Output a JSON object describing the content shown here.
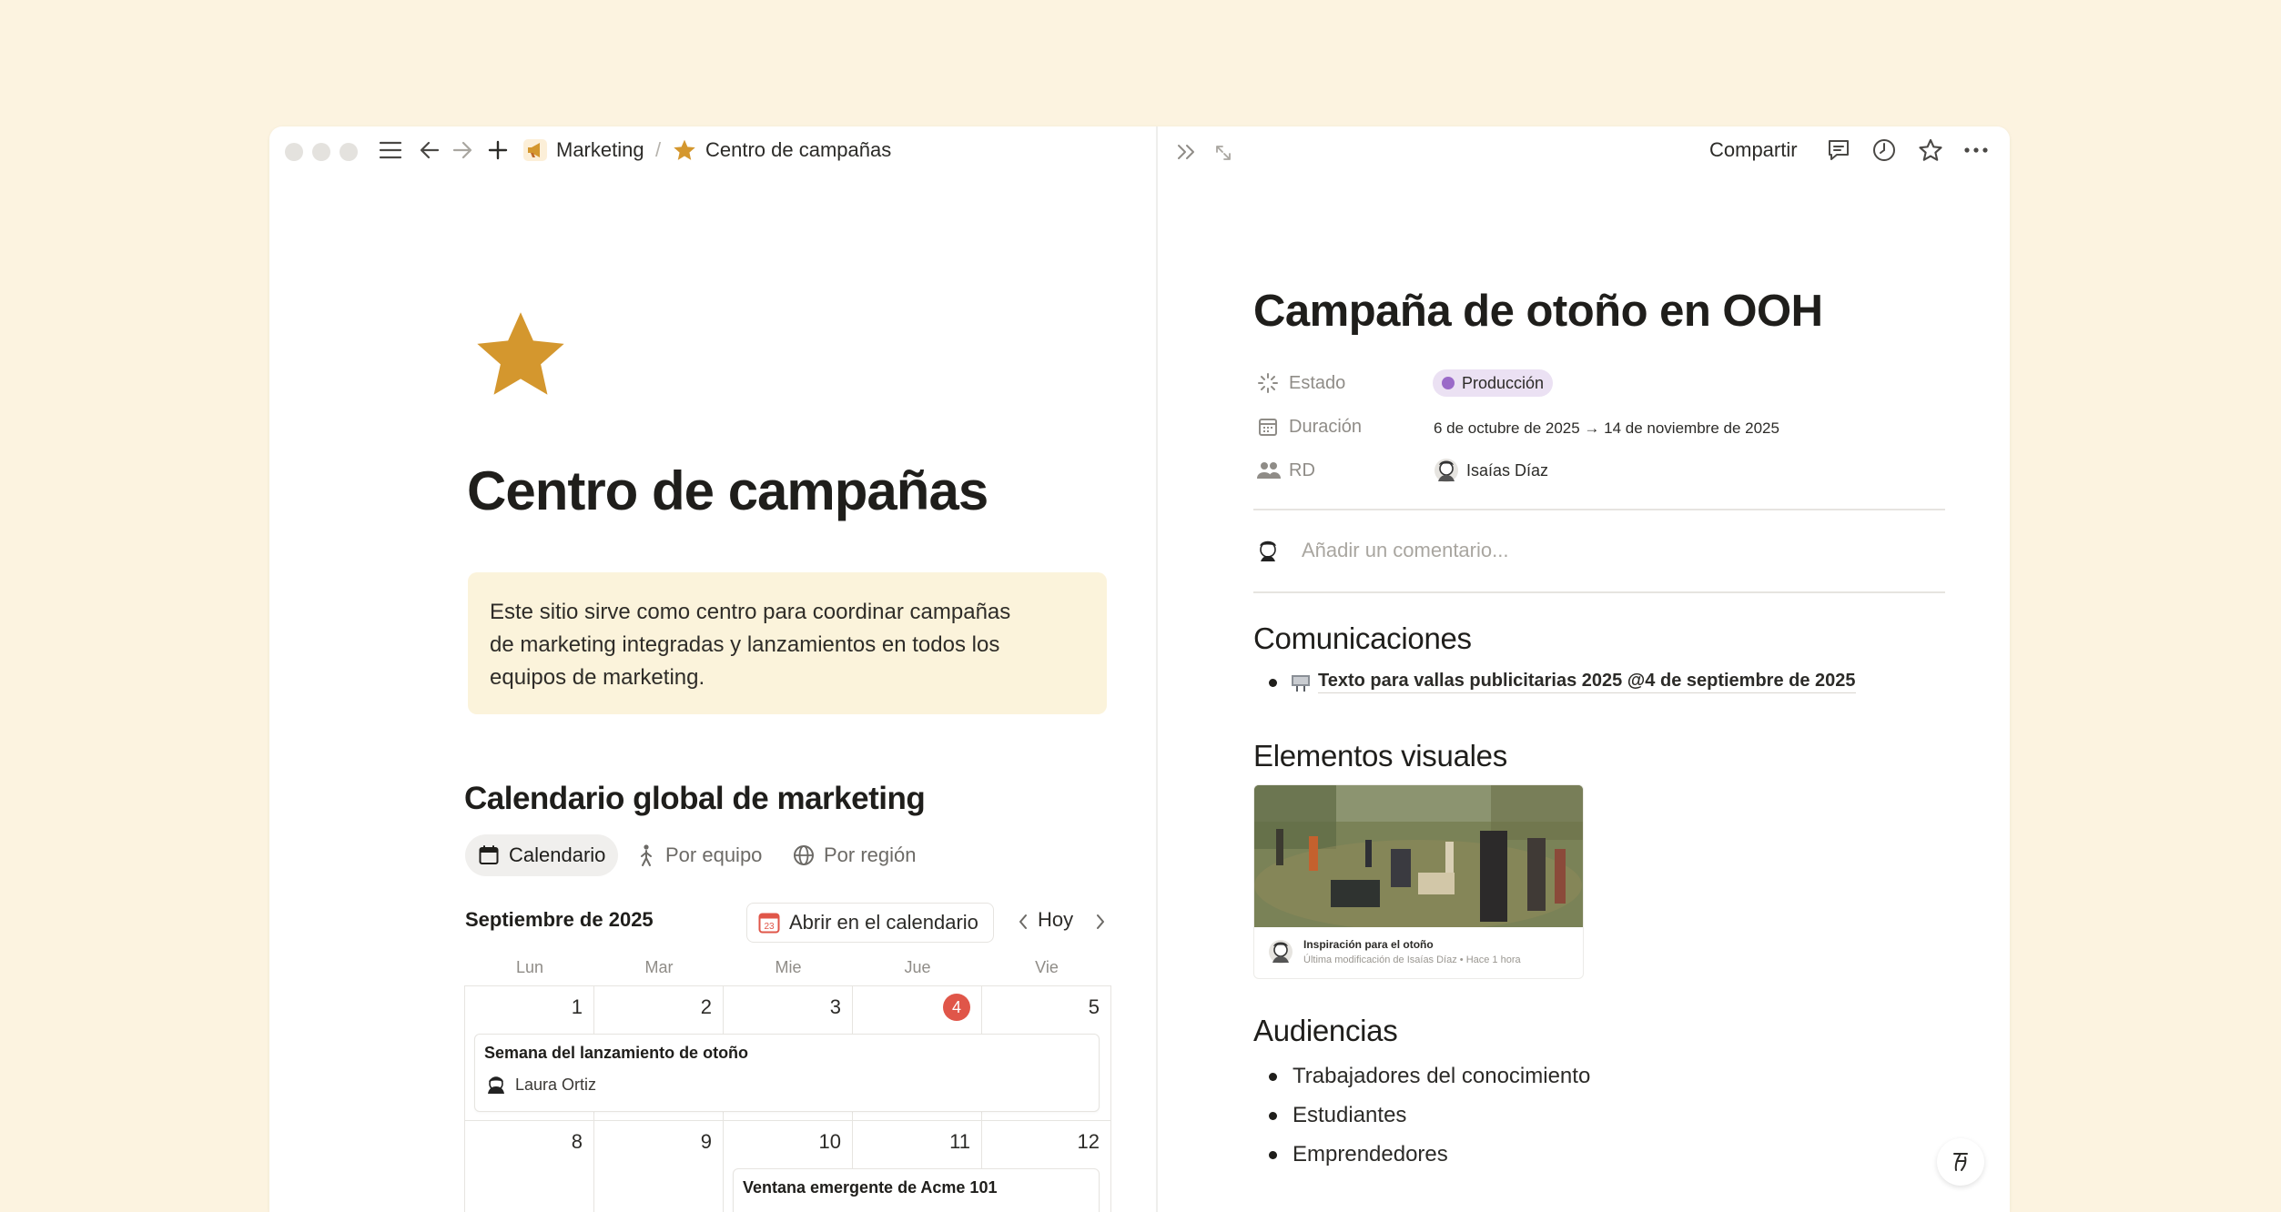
{
  "breadcrumb": {
    "parent": "Marketing",
    "separator": "/",
    "current": "Centro de campañas"
  },
  "topbar_right": {
    "share_label": "Compartir"
  },
  "left_page": {
    "title": "Centro de campañas",
    "callout_lines": [
      "Este sitio sirve como centro para coordinar campañas",
      "de marketing integradas y lanzamientos en todos los",
      "equipos de marketing."
    ],
    "section_title": "Calendario global de marketing",
    "view_tabs": [
      "Calendario",
      "Por equipo",
      "Por región"
    ],
    "calendar": {
      "month_label": "Septiembre de 2025",
      "open_button": "Abrir en el calendario",
      "open_icon_day": "23",
      "today_label": "Hoy",
      "weekdays": [
        "Lun",
        "Mar",
        "Mie",
        "Jue",
        "Vie"
      ],
      "week1": [
        "1",
        "2",
        "3",
        "4",
        "5"
      ],
      "week2": [
        "8",
        "9",
        "10",
        "11",
        "12"
      ],
      "event1": {
        "title": "Semana del lanzamiento de otoño",
        "person": "Laura Ortiz"
      },
      "event2": {
        "title": "Ventana emergente de Acme 101"
      }
    }
  },
  "right_panel": {
    "title": "Campaña de otoño en OOH",
    "props": {
      "status_label": "Estado",
      "status_value": "Producción",
      "status_color": "#9a6ac8",
      "duration_label": "Duración",
      "duration_value": "6 de octubre de 2025 → 14 de noviembre de 2025",
      "owner_label": "RD",
      "owner_value": "Isaías Díaz"
    },
    "comment_placeholder": "Añadir un comentario...",
    "communications_title": "Comunicaciones",
    "communications_item": "Texto para vallas publicitarias 2025 @4 de septiembre de 2025",
    "visuals_title": "Elementos visuales",
    "visual_caption": "Inspiración para el otoño",
    "visual_sub": "Última modificación de Isaías Díaz • Hace 1 hora",
    "audiences_title": "Audiencias",
    "audiences": [
      "Trabajadores del conocimiento",
      "Estudiantes",
      "Emprendedores"
    ]
  },
  "colors": {
    "background": "#fcf3e0",
    "star": "#d4972e",
    "today_badge": "#e05649",
    "callout_bg": "#fbf3db"
  }
}
